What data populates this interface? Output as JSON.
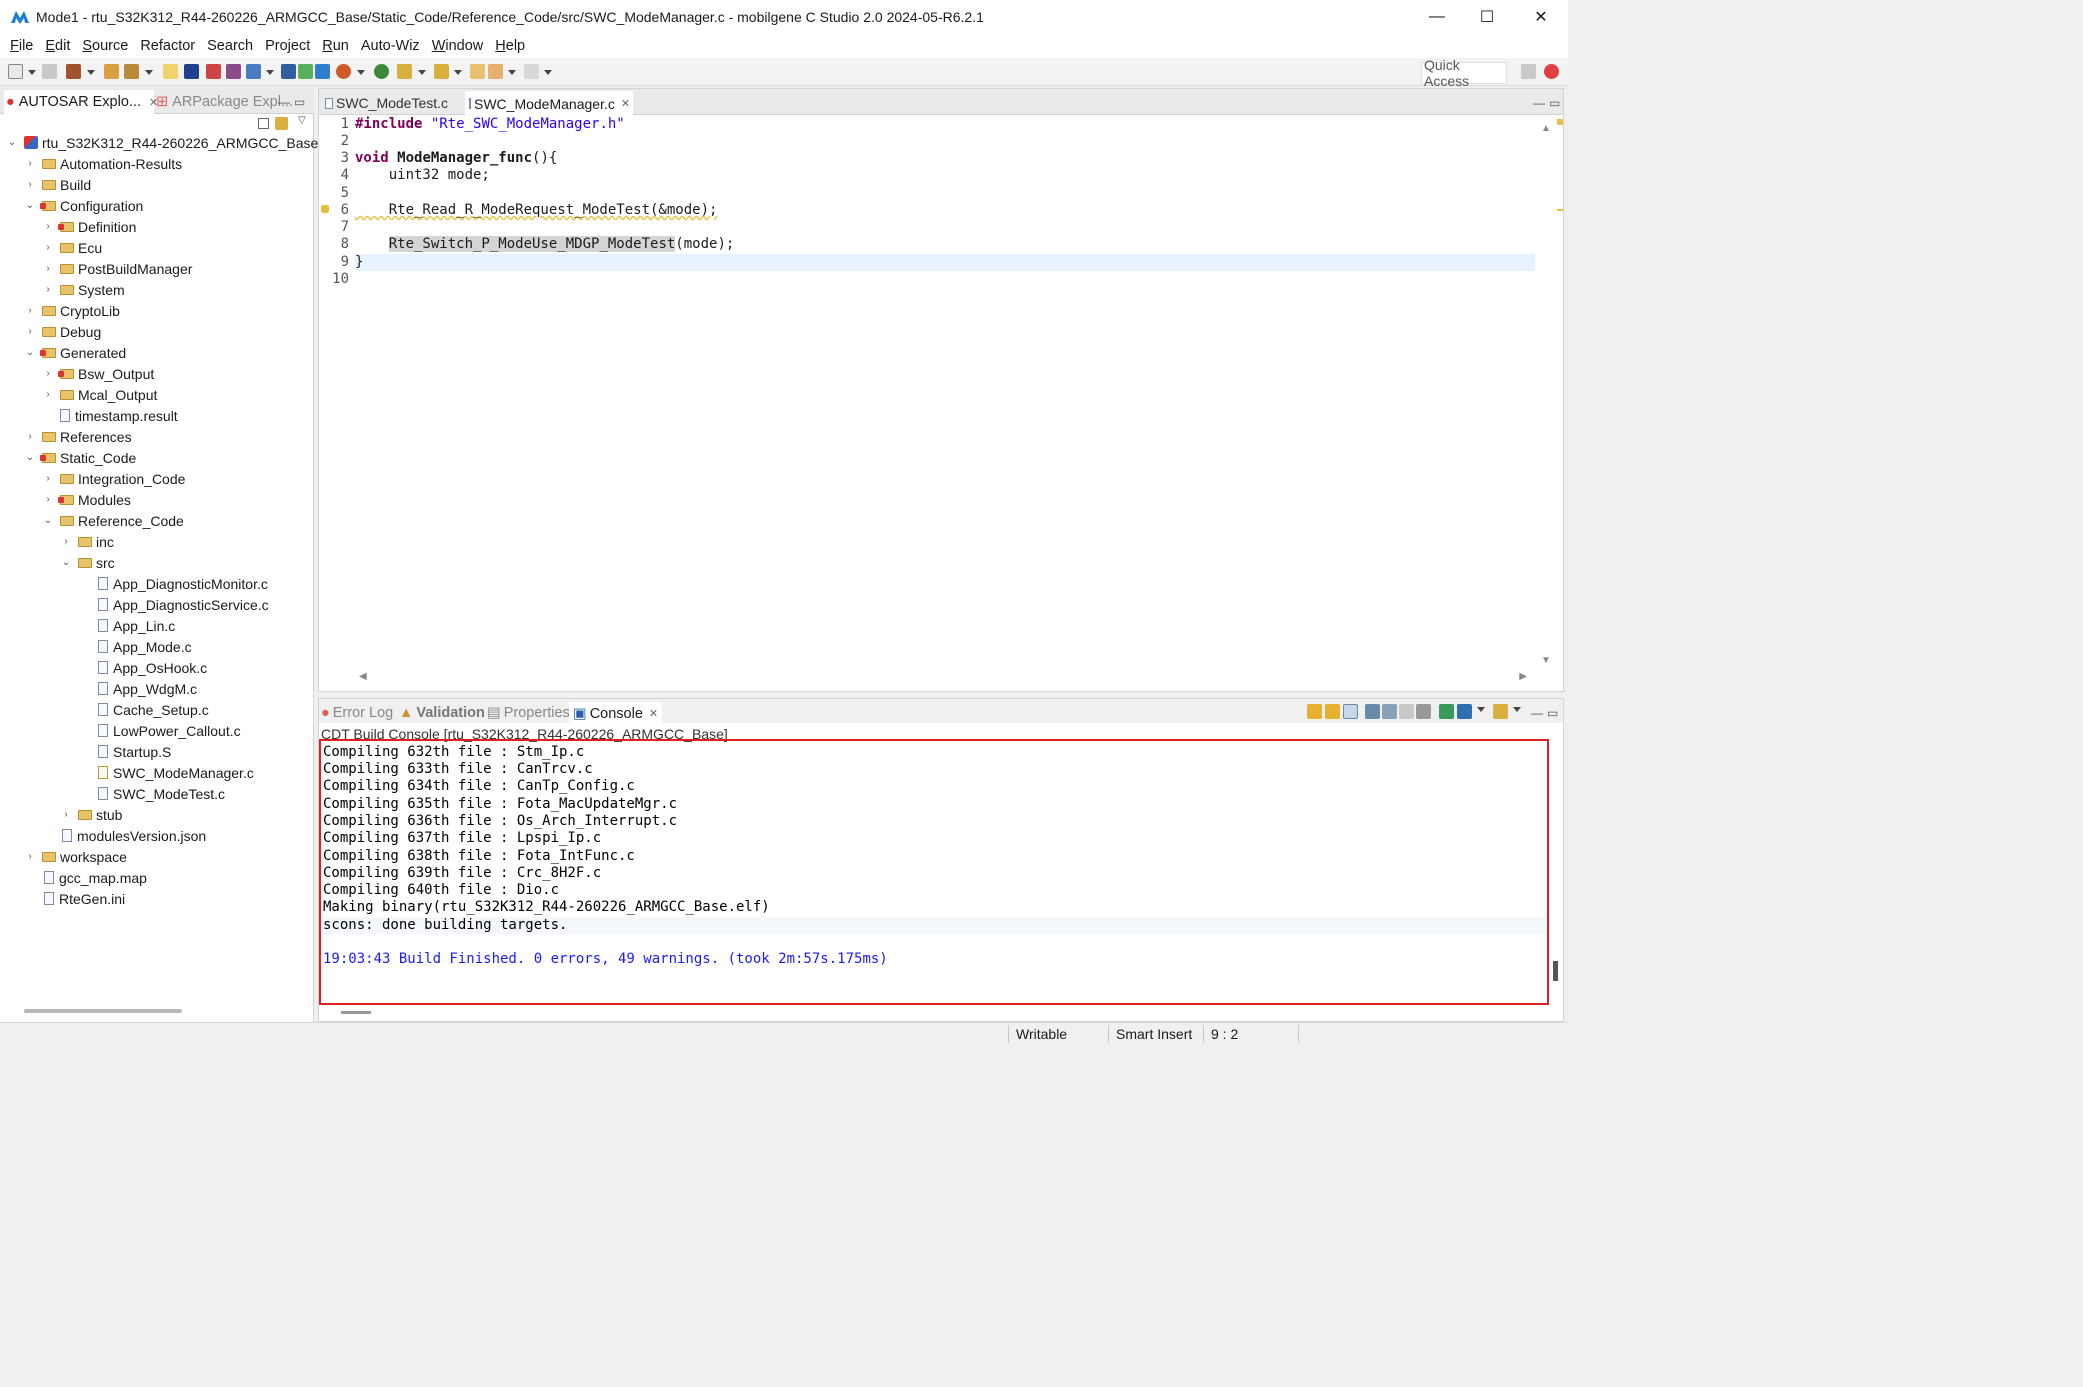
{
  "window": {
    "title": "Mode1 - rtu_S32K312_R44-260226_ARMGCC_Base/Static_Code/Reference_Code/src/SWC_ModeManager.c - mobilgene C Studio 2.0 2024-05-R6.2.1",
    "minimize": "—",
    "maximize": "☐",
    "close": "✕"
  },
  "menu": [
    {
      "first": "F",
      "rest": "ile"
    },
    {
      "first": "E",
      "rest": "dit"
    },
    {
      "first": "S",
      "rest": "ource"
    },
    {
      "first": "",
      "rest": "Refactor"
    },
    {
      "first": "",
      "rest": "Search"
    },
    {
      "first": "",
      "rest": "Project"
    },
    {
      "first": "R",
      "rest": "un"
    },
    {
      "first": "",
      "rest": "Auto-Wiz"
    },
    {
      "first": "W",
      "rest": "indow"
    },
    {
      "first": "H",
      "rest": "elp"
    }
  ],
  "toolbar": {
    "quick_access": "Quick Access"
  },
  "left_panel": {
    "tabs": [
      "AUTOSAR Explo...",
      "ARPackage Expl..."
    ],
    "tree": [
      {
        "label": "rtu_S32K312_R44-260226_ARMGCC_Base",
        "type": "project",
        "expanded": true
      },
      {
        "label": "Automation-Results",
        "type": "folder"
      },
      {
        "label": "Build",
        "type": "folder"
      },
      {
        "label": "Configuration",
        "type": "folder-red",
        "expanded": true
      },
      {
        "label": "Definition",
        "type": "folder-red"
      },
      {
        "label": "Ecu",
        "type": "folder"
      },
      {
        "label": "PostBuildManager",
        "type": "folder"
      },
      {
        "label": "System",
        "type": "folder"
      },
      {
        "label": "CryptoLib",
        "type": "folder"
      },
      {
        "label": "Debug",
        "type": "folder"
      },
      {
        "label": "Generated",
        "type": "folder-red",
        "expanded": true
      },
      {
        "label": "Bsw_Output",
        "type": "folder-red"
      },
      {
        "label": "Mcal_Output",
        "type": "folder"
      },
      {
        "label": "timestamp.result",
        "type": "file"
      },
      {
        "label": "References",
        "type": "folder"
      },
      {
        "label": "Static_Code",
        "type": "folder-red",
        "expanded": true
      },
      {
        "label": "Integration_Code",
        "type": "folder"
      },
      {
        "label": "Modules",
        "type": "folder-red"
      },
      {
        "label": "Reference_Code",
        "type": "folder",
        "expanded": true
      },
      {
        "label": "inc",
        "type": "folder"
      },
      {
        "label": "src",
        "type": "folder",
        "expanded": true
      },
      {
        "label": "App_DiagnosticMonitor.c",
        "type": "file"
      },
      {
        "label": "App_DiagnosticService.c",
        "type": "file"
      },
      {
        "label": "App_Lin.c",
        "type": "file"
      },
      {
        "label": "App_Mode.c",
        "type": "file"
      },
      {
        "label": "App_OsHook.c",
        "type": "file"
      },
      {
        "label": "App_WdgM.c",
        "type": "file"
      },
      {
        "label": "Cache_Setup.c",
        "type": "file"
      },
      {
        "label": "LowPower_Callout.c",
        "type": "file"
      },
      {
        "label": "Startup.S",
        "type": "file"
      },
      {
        "label": "SWC_ModeManager.c",
        "type": "file"
      },
      {
        "label": "SWC_ModeTest.c",
        "type": "file"
      },
      {
        "label": "stub",
        "type": "folder"
      },
      {
        "label": "modulesVersion.json",
        "type": "file"
      },
      {
        "label": "workspace",
        "type": "folder"
      },
      {
        "label": "gcc_map.map",
        "type": "file"
      },
      {
        "label": "RteGen.ini",
        "type": "file"
      }
    ]
  },
  "editor": {
    "tabs": [
      "SWC_ModeTest.c",
      "SWC_ModeManager.c"
    ],
    "line_numbers": [
      "1",
      "2",
      "3",
      "4",
      "5",
      "6",
      "7",
      "8",
      "9",
      "10"
    ],
    "code": {
      "l1_kw": "#include",
      "l1_str": "\"Rte_SWC_ModeManager.h\"",
      "l3_kw": "void",
      "l3_fn": "ModeManager_func",
      "l3_rest": "(){",
      "l4": "    uint32 mode;",
      "l6": "    Rte_Read_R_ModeRequest_ModeTest(&mode);",
      "l8_fn": "Rte_Switch_P_ModeUse_MDGP_ModeTest",
      "l8_rest": "(mode);",
      "l9": "}"
    }
  },
  "console": {
    "tabs": [
      "Error Log",
      "Validation",
      "Properties",
      "Console"
    ],
    "title": "CDT Build Console [rtu_S32K312_R44-260226_ARMGCC_Base]",
    "lines": [
      "Compiling 632th file : Stm_Ip.c",
      "Compiling 633th file : CanTrcv.c",
      "Compiling 634th file : CanTp_Config.c",
      "Compiling 635th file : Fota_MacUpdateMgr.c",
      "Compiling 636th file : Os_Arch_Interrupt.c",
      "Compiling 637th file : Lpspi_Ip.c",
      "Compiling 638th file : Fota_IntFunc.c",
      "Compiling 639th file : Crc_8H2F.c",
      "Compiling 640th file : Dio.c",
      "Making binary(rtu_S32K312_R44-260226_ARMGCC_Base.elf)",
      "scons: done building targets."
    ],
    "result": "19:03:43 Build Finished. 0 errors, 49 warnings. (took 2m:57s.175ms)"
  },
  "status": {
    "writable": "Writable",
    "insert": "Smart Insert",
    "position": "9 : 2"
  }
}
